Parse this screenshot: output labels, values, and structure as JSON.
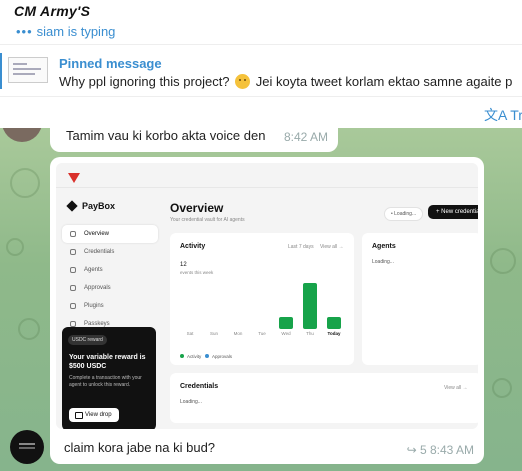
{
  "header": {
    "title": "CM Army'S",
    "typing_dots": "•••",
    "typing": "siam is typing"
  },
  "pinned": {
    "label": "Pinned message",
    "text_before": "Why ppl ignoring this project?",
    "text_after": "Jei koyta tweet korlam ektao samne agaite p"
  },
  "translate": {
    "label": "文A Tra"
  },
  "messages": {
    "prev": {
      "text": "Tamim vau ki korbo akta voice den",
      "time": "8:42 AM"
    },
    "main": {
      "caption": "claim kora jabe na ki bud?",
      "meta": "↪ 5  8:43 AM"
    }
  },
  "app": {
    "brand": "PayBox",
    "nav": [
      "Overview",
      "Credentials",
      "Agents",
      "Approvals",
      "Plugins",
      "Passkeys"
    ],
    "reward": {
      "pill": "USDC reward",
      "title": "Your variable reward is $500 USDC",
      "desc": "Complete a transaction with your agent to unlock this reward.",
      "button": "View drop"
    },
    "overview": {
      "title": "Overview",
      "subtitle": "Your credential vault for AI agents",
      "loading_btn": "• Loading...",
      "new_btn": "+ New credential"
    },
    "activity": {
      "title": "Activity",
      "range": "Last 7 days",
      "view_all": "View all →",
      "count": "12",
      "count_label": "events this week",
      "legend_activity": "Activity",
      "legend_approvals": "Approvals"
    },
    "agents": {
      "title": "Agents",
      "loading": "Loading..."
    },
    "credentials": {
      "title": "Credentials",
      "view_all": "View all →",
      "loading": "Loading..."
    }
  },
  "chart_data": {
    "type": "bar",
    "categories": [
      "Sat",
      "Sun",
      "Mon",
      "Tue",
      "Wed",
      "Thu",
      "Today"
    ],
    "values": [
      0,
      0,
      0,
      0,
      2,
      8,
      2
    ],
    "ylim": [
      0,
      8
    ]
  },
  "colors": {
    "accent": "#3a8ed0",
    "bar": "#17a34a",
    "approvals": "#3a8ed0"
  }
}
